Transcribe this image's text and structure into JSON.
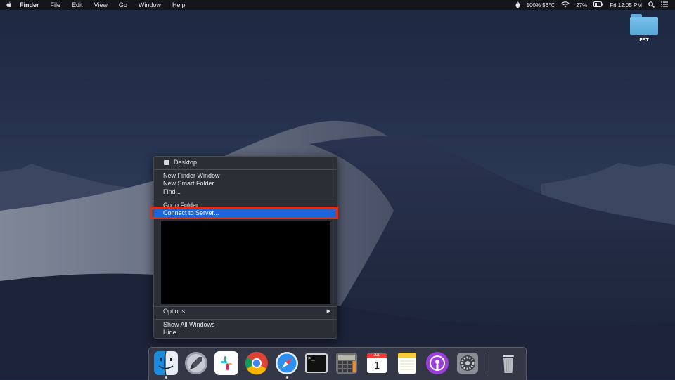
{
  "menubar": {
    "apple": "",
    "app_name": "Finder",
    "items": [
      "File",
      "Edit",
      "View",
      "Go",
      "Window",
      "Help"
    ],
    "status": {
      "temperature": "100% 56°C",
      "battery": "27%",
      "clock": "Fri 12:05 PM"
    }
  },
  "desktop": {
    "folder_label": "FST"
  },
  "context_menu": {
    "header": "Desktop",
    "items": {
      "new_finder_window": "New Finder Window",
      "new_smart_folder": "New Smart Folder",
      "find": "Find...",
      "go_to_folder": "Go to Folder...",
      "connect_to_server": "Connect to Server...",
      "options": "Options",
      "show_all_windows": "Show All Windows",
      "hide": "Hide"
    },
    "submenu_arrow": "▶"
  },
  "dock": {
    "apps": [
      "finder",
      "launchpad",
      "slack",
      "chrome",
      "safari",
      "terminal",
      "calculator",
      "calendar",
      "notes",
      "podcasts",
      "system-preferences",
      "trash"
    ],
    "calendar_day": "1",
    "calendar_month": "JUL",
    "terminal_prompt": ">_"
  },
  "colors": {
    "highlight": "#1f63d8",
    "annotation_box": "#d7321f"
  }
}
